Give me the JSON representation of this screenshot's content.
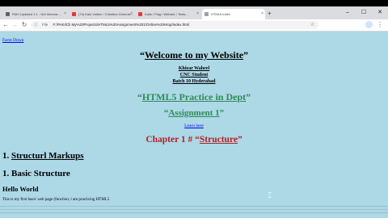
{
  "browser": {
    "tabs": [
      {
        "title": "PAKI Updated 1.1 - Get Informa..."
      },
      {
        "title": "(74) Kalo Volken / Christina Grimmie..."
      },
      {
        "title": "Katis / Flag / Website / Tests..."
      },
      {
        "title": "HTML5 Index"
      }
    ],
    "new_tab": "+",
    "controls": {
      "minimize": "–",
      "maximize": "☐",
      "close": "✕"
    },
    "toolbar": {
      "back": "←",
      "forward": "→",
      "reload": "↻",
      "info": "ⓘ",
      "scheme": "File",
      "url": "F:/PAKI/Cli My%20Projects/HTML5%20Assignment%201/Online%20Htop/index.html",
      "star": "☆",
      "menu": "⋮"
    }
  },
  "page": {
    "top_link": "Farm Down",
    "welcome": {
      "open": "“",
      "text": "Welcome to my Website",
      "close": "”"
    },
    "author": {
      "name": "Khizar Waheel",
      "role": "CNC Student",
      "batch": "Batch 10 Hyderabad"
    },
    "practice": {
      "open": "“",
      "text": "HTML5 Practice in Dept",
      "close": "”"
    },
    "assignment": {
      "open": "“",
      "text": "Assignment 1",
      "close": "”"
    },
    "learn_link": "Learn here",
    "chapter": {
      "prefix": "Chapter 1 # “",
      "text": "Structure",
      "close": "”"
    },
    "h_markups": {
      "num": "1. ",
      "text": "Structurl Markups"
    },
    "h_basic": "1. Basic Structure",
    "hello": "Hello World",
    "paragraph": "This is my first basic web page (function; i am practicing HTML5"
  },
  "colors": {
    "background": "#add8e6",
    "green": "#2e8b57",
    "red": "#b22222",
    "link": "#0000ee"
  }
}
